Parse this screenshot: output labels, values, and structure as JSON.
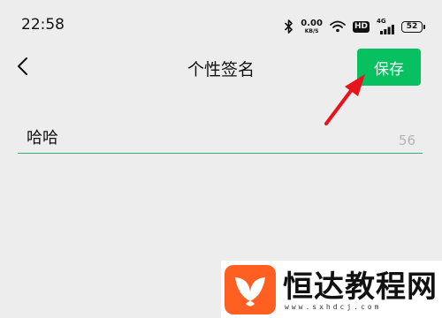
{
  "status_bar": {
    "time": "22:58",
    "net_speed_value": "0.00",
    "net_speed_unit": "KB/S",
    "hd_label": "HD",
    "network_type": "4G",
    "battery": "52",
    "icons": [
      "bluetooth-icon",
      "wifi-icon",
      "signal-icon",
      "battery-icon"
    ]
  },
  "header": {
    "title": "个性签名",
    "back_icon": "chevron-left-icon",
    "save_label": "保存"
  },
  "signature": {
    "value": "哈哈",
    "remaining_chars": "56"
  },
  "watermark": {
    "name": "恒达教程网",
    "url": "www.sxhdcj.com"
  },
  "colors": {
    "accent": "#07c160",
    "background": "#ededed",
    "field_underline": "#2fb37a",
    "annotation": "#e8141c",
    "watermark_logo": "#ff6022"
  }
}
